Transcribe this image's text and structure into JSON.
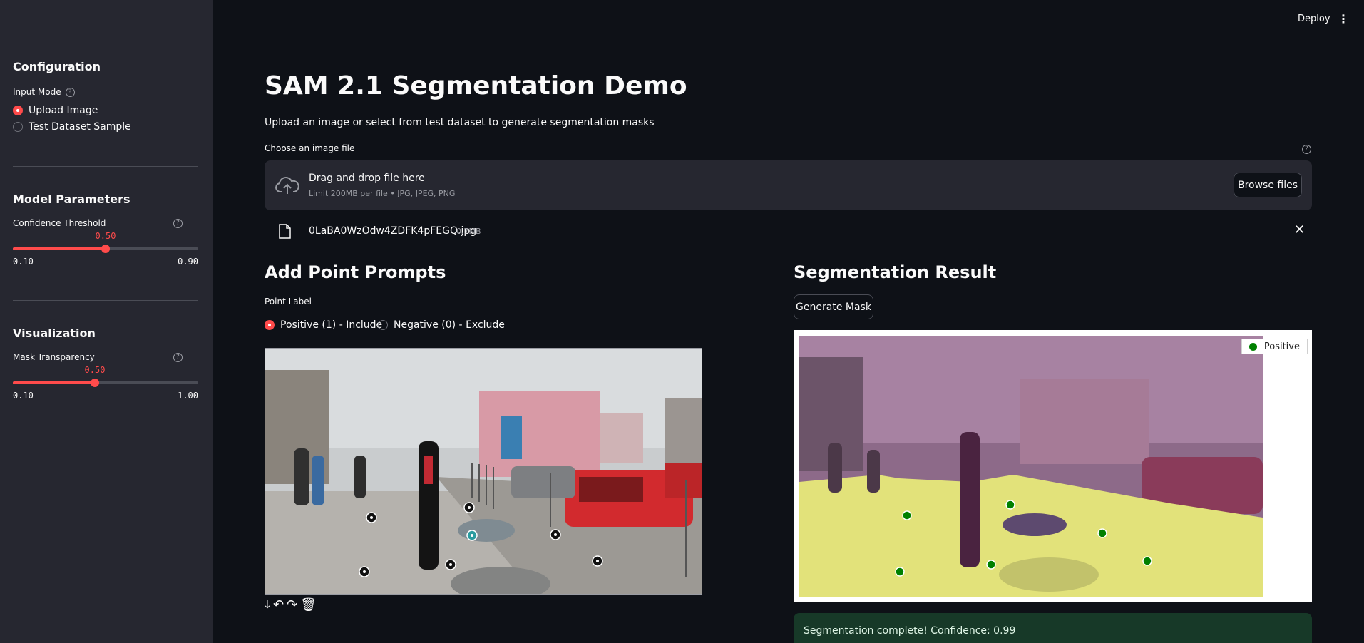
{
  "header": {
    "deploy_label": "Deploy",
    "menu_icon": "kebab-menu-icon"
  },
  "sidebar": {
    "config_title": "Configuration",
    "input_mode": {
      "label": "Input Mode",
      "options": [
        {
          "label": "Upload Image",
          "selected": true
        },
        {
          "label": "Test Dataset Sample",
          "selected": false
        }
      ]
    },
    "model_params_title": "Model Parameters",
    "confidence": {
      "label": "Confidence Threshold",
      "value": "0.50",
      "min": "0.10",
      "max": "0.90",
      "fraction": 0.5
    },
    "visualization_title": "Visualization",
    "transparency": {
      "label": "Mask Transparency",
      "value": "0.50",
      "min": "0.10",
      "max": "1.00",
      "fraction": 0.444
    }
  },
  "main": {
    "title": "SAM 2.1 Segmentation Demo",
    "subtitle": "Upload an image or select from test dataset to generate segmentation masks",
    "uploader": {
      "label": "Choose an image file",
      "drop_text": "Drag and drop file here",
      "limit_text": "Limit 200MB per file • JPG, JPEG, PNG",
      "browse_label": "Browse files"
    },
    "file": {
      "name": "0LaBA0WzOdw4ZDFK4pFEGQ.jpg",
      "size": "0.7MB"
    },
    "prompts": {
      "title": "Add Point Prompts",
      "point_label": "Point Label",
      "options": [
        {
          "label": "Positive (1) - Include",
          "selected": true
        },
        {
          "label": "Negative (0) - Exclude",
          "selected": false
        }
      ],
      "tools": [
        "download-icon",
        "undo-icon",
        "redo-icon",
        "trash-icon"
      ]
    },
    "result": {
      "title": "Segmentation Result",
      "generate_label": "Generate Mask",
      "legend_label": "Positive",
      "success_text": "Segmentation complete! Confidence: 0.99"
    }
  },
  "colors": {
    "accent": "#ff4b4b",
    "sidebar_bg": "#262730",
    "main_bg": "#0e1117",
    "success_bg": "#173928",
    "mask": "#e8e86a",
    "positive_point": "#008000"
  }
}
